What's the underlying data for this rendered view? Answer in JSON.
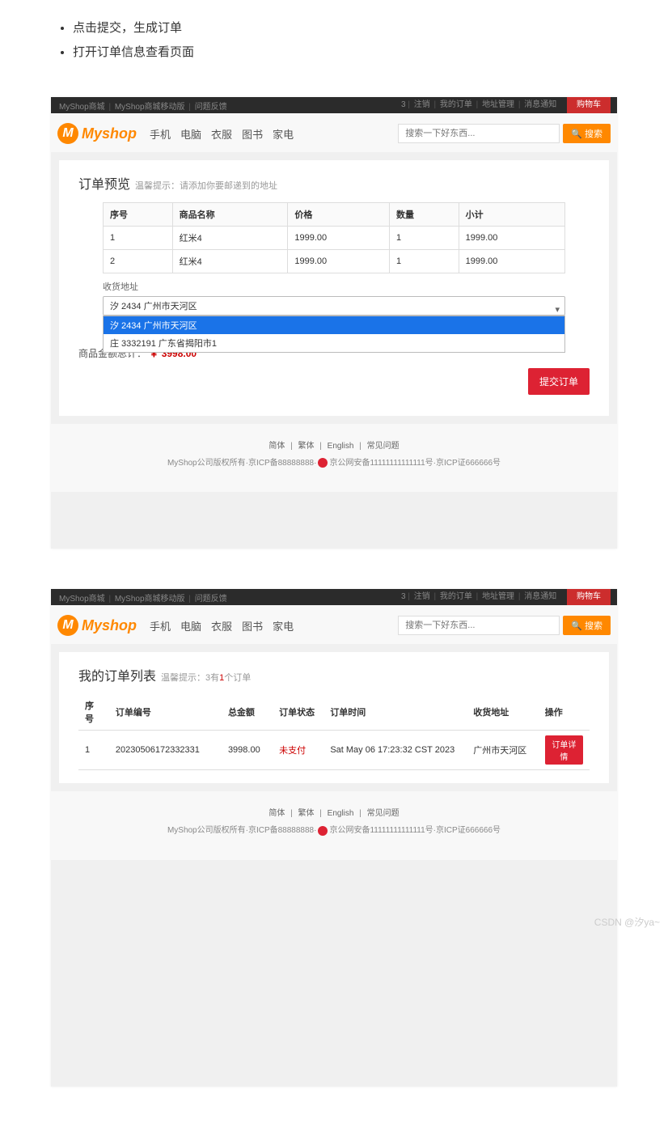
{
  "bullets": [
    "点击提交，生成订单",
    "打开订单信息查看页面"
  ],
  "topbar": {
    "left": [
      "MyShop商城",
      "MyShop商城移动版",
      "问题反馈"
    ],
    "right_items": [
      "注销",
      "我的订单",
      "地址管理",
      "消息通知"
    ],
    "user_mark": "3",
    "cart": "购物车"
  },
  "brand": {
    "m": "M",
    "name": "Myshop"
  },
  "nav": [
    "手机",
    "电脑",
    "衣服",
    "图书",
    "家电"
  ],
  "search": {
    "placeholder": "搜索一下好东西...",
    "btn": "搜索"
  },
  "shot1": {
    "title": "订单预览",
    "tip": "温馨提示：请添加你要邮递到的地址",
    "cols": [
      "序号",
      "商品名称",
      "价格",
      "数量",
      "小计"
    ],
    "rows": [
      {
        "idx": "1",
        "name": "红米4",
        "price": "1999.00",
        "qty": "1",
        "sub": "1999.00"
      },
      {
        "idx": "2",
        "name": "红米4",
        "price": "1999.00",
        "qty": "1",
        "sub": "1999.00"
      }
    ],
    "addr_label": "收货地址",
    "addr_selected": "汐  2434  广州市天河区",
    "addr_options": [
      "汐  2434  广州市天河区",
      "庄  3332191  广东省揭阳市1"
    ],
    "total_label": "商品金额总计：",
    "total_amt": "￥  3998.00",
    "submit": "提交订单"
  },
  "shot2": {
    "title": "我的订单列表",
    "tip_pre": "温馨提示：3有",
    "tip_n": "1",
    "tip_post": "个订单",
    "cols": [
      "序号",
      "订单编号",
      "总金额",
      "订单状态",
      "订单时间",
      "收货地址",
      "操作"
    ],
    "rows": [
      {
        "idx": "1",
        "no": "20230506172332331",
        "amt": "3998.00",
        "status": "未支付",
        "time": "Sat May 06 17:23:32 CST 2023",
        "addr": "广州市天河区",
        "op": "订单详情"
      }
    ]
  },
  "footer": {
    "links": [
      "简体",
      "繁体",
      "English",
      "常见问题"
    ],
    "cp1": "MyShop公司版权所有·京ICP备88888888·",
    "cp2": "京公网安备11111111111111号·京ICP证666666号"
  },
  "watermark": "CSDN @汐ya~"
}
